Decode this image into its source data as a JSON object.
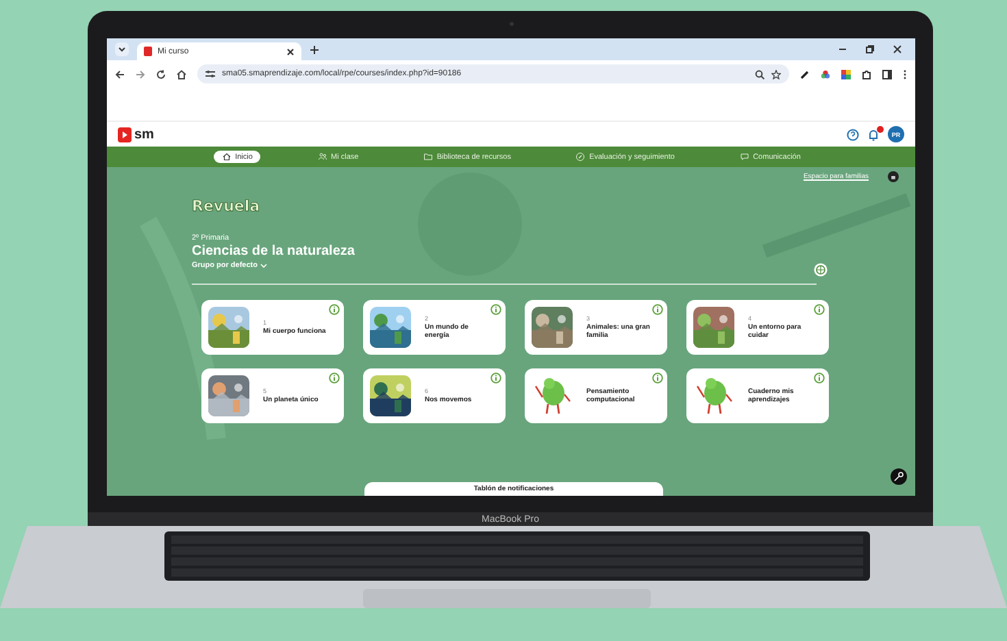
{
  "browser": {
    "tab_title": "Mi curso",
    "url": "sma05.smaprendizaje.com/local/rpe/courses/index.php?id=90186"
  },
  "header": {
    "logo": "sm",
    "avatar": "PR",
    "notifications_unread": true
  },
  "nav": [
    {
      "label": "Inicio",
      "selected": true
    },
    {
      "label": "Mi clase",
      "selected": false
    },
    {
      "label": "Biblioteca de recursos",
      "selected": false
    },
    {
      "label": "Evaluación y seguimiento",
      "selected": false
    },
    {
      "label": "Comunicación",
      "selected": false
    }
  ],
  "hero": {
    "families_link": "Espacio para familias",
    "brand": "Revuela",
    "grade": "2º Primaria",
    "title": "Ciencias de la naturaleza",
    "group": "Grupo por defecto"
  },
  "units": [
    {
      "number": "1",
      "title": "Mi cuerpo funciona"
    },
    {
      "number": "2",
      "title": "Un mundo de energía"
    },
    {
      "number": "3",
      "title": "Animales: una gran familia"
    },
    {
      "number": "4",
      "title": "Un entorno para cuidar"
    },
    {
      "number": "5",
      "title": "Un planeta único"
    },
    {
      "number": "6",
      "title": "Nos movemos"
    },
    {
      "title": "Pensamiento computacional",
      "kind": "mascot"
    },
    {
      "title": "Cuaderno mis aprendizajes",
      "kind": "mascot"
    }
  ],
  "notice_board": "Tablón de notificaciones",
  "laptop_label": "MacBook Pro"
}
